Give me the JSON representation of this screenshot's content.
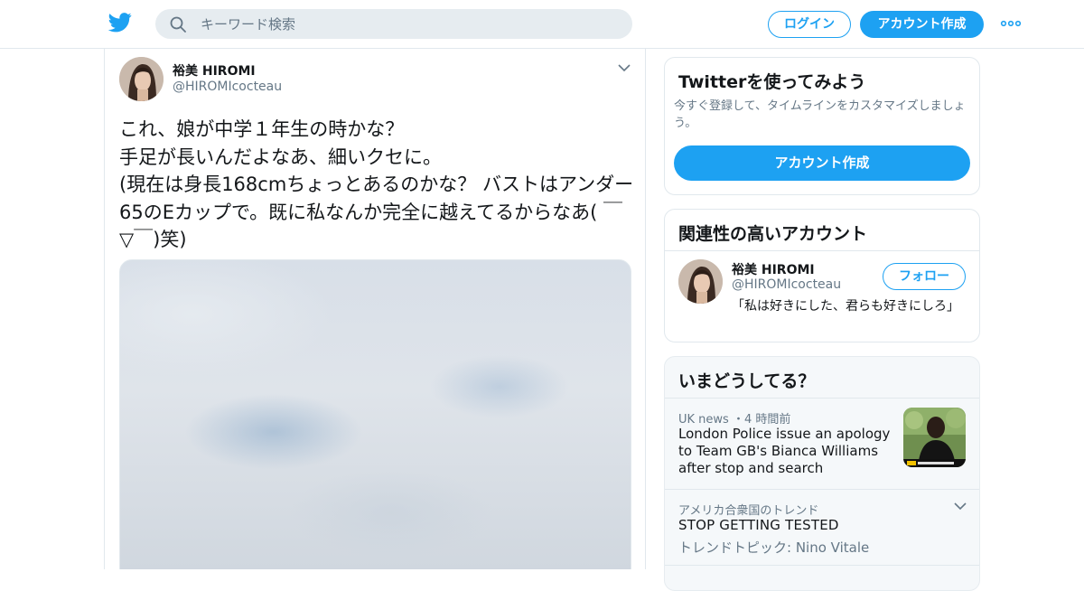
{
  "header": {
    "search_placeholder": "キーワード検索",
    "login_label": "ログイン",
    "signup_label": "アカウント作成",
    "brand_color": "#1da1f2"
  },
  "tweet": {
    "author_name": "裕美 HIROMI",
    "author_handle": "@HIROMIcocteau",
    "text": "これ、娘が中学１年生の時かな？\n手足が長いんだよなあ、細いクセに。\n(現在は身長168cmちょっとあるのかな？ バストはアンダー65のEカップで。既に私なんか完全に越えてるからなあ( ￣▽￣)笑)"
  },
  "sidebar": {
    "try_card": {
      "title": "Twitterを使ってみよう",
      "description": "今すぐ登録して、タイムラインをカスタマイズしましょう。",
      "cta_label": "アカウント作成"
    },
    "related_card": {
      "title": "関連性の高いアカウント",
      "account": {
        "name": "裕美 HIROMI",
        "handle": "@HIROMIcocteau",
        "bio": "「私は好きにした、君らも好きにしろ」",
        "follow_label": "フォロー"
      }
    },
    "trends_card": {
      "title": "いまどうしてる？",
      "items": [
        {
          "meta": "UK news ・4 時間前",
          "title": "London Police issue an apology to Team GB's Bianca Williams after stop and search"
        },
        {
          "meta": "アメリカ合衆国のトレンド",
          "title": "STOP GETTING TESTED",
          "subtitle": "トレンドトピック: Nino Vitale"
        }
      ]
    }
  },
  "icons": {
    "logo": "twitter-bird-icon",
    "search": "search-icon",
    "more": "more-dots-icon",
    "caret": "chevron-down-icon"
  }
}
